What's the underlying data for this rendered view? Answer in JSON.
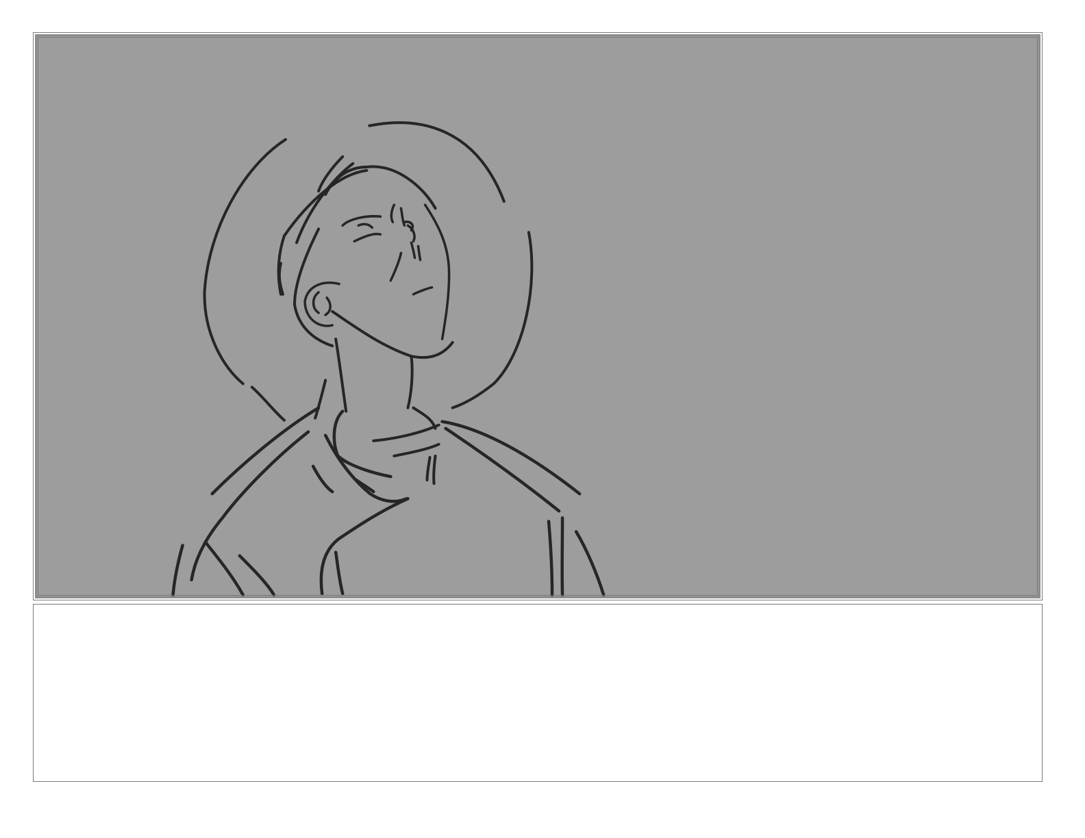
{
  "storyboard": {
    "panel": {
      "image": "pencil-sketch-figure-looking-up-with-halo",
      "background_color": "#9d9d9d",
      "line_color": "#262626"
    },
    "notes": {
      "text": ""
    }
  }
}
